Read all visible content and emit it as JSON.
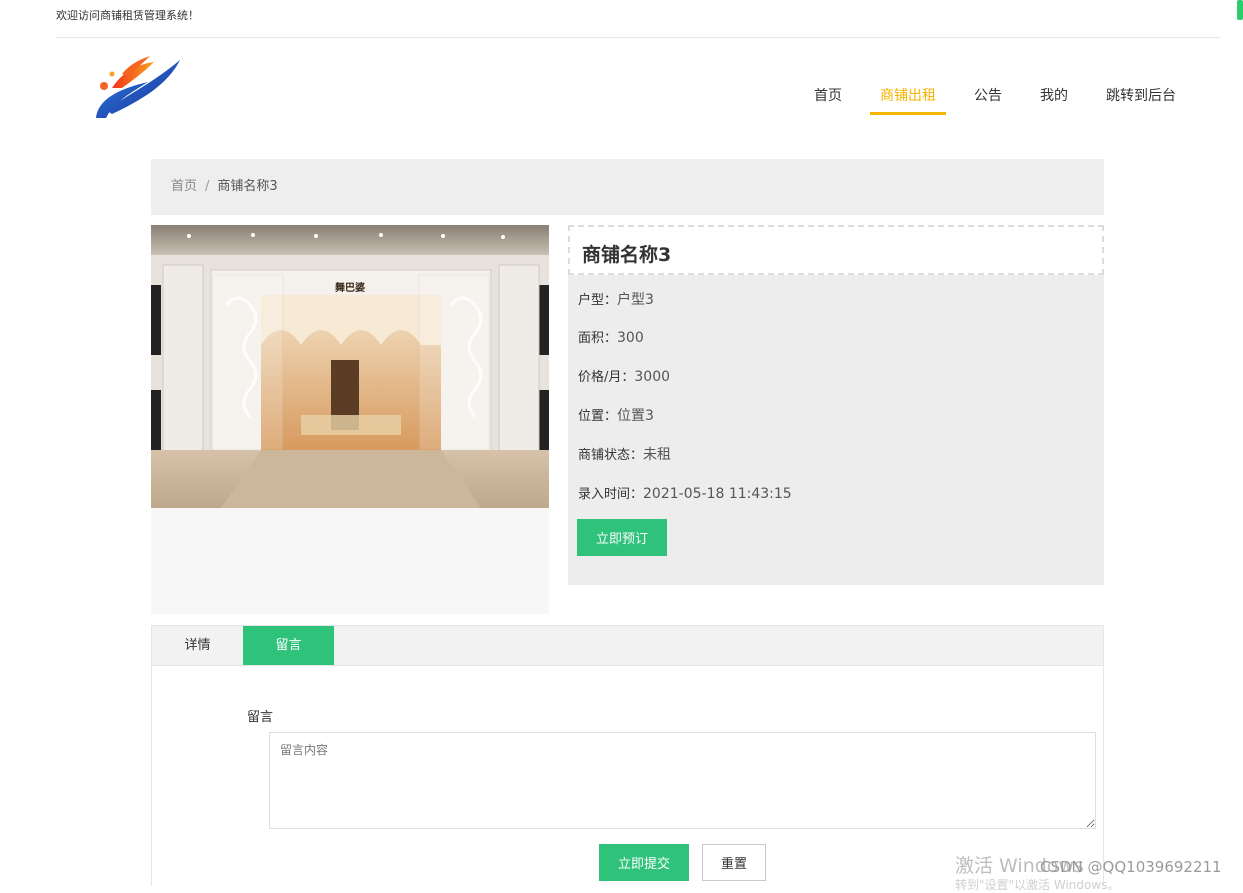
{
  "topbar": {
    "welcome": "欢迎访问商铺租赁管理系统！"
  },
  "nav": {
    "items": [
      {
        "label": "首页"
      },
      {
        "label": "商铺出租"
      },
      {
        "label": "公告"
      },
      {
        "label": "我的"
      },
      {
        "label": "跳转到后台"
      }
    ],
    "active_index": 1
  },
  "colors": {
    "accent": "#f5b400",
    "primary_button": "#2fc27a"
  },
  "breadcrumb": {
    "home": "首页",
    "separator": "/",
    "current": "商铺名称3"
  },
  "shop": {
    "title": "商铺名称3",
    "image_sign": "舞巴婆",
    "fields": [
      {
        "key": "户型：",
        "value": "户型3"
      },
      {
        "key": "面积：",
        "value": "300"
      },
      {
        "key": "价格/月：",
        "value": "3000"
      },
      {
        "key": "位置：",
        "value": "位置3"
      },
      {
        "key": "商铺状态：",
        "value": "未租"
      },
      {
        "key": "录入时间：",
        "value": "2021-05-18 11:43:15"
      }
    ],
    "book_label": "立即预订"
  },
  "tabs": {
    "items": [
      {
        "label": "详情"
      },
      {
        "label": "留言"
      }
    ],
    "active_index": 1
  },
  "comment_form": {
    "label": "留言",
    "placeholder": "留言内容",
    "submit_label": "立即提交",
    "reset_label": "重置"
  },
  "overlay": {
    "watermark": "激活 Windows",
    "watermark_sub": "转到\"设置\"以激活 Windows。",
    "csdn": "CSDN @QQ1039692211"
  }
}
